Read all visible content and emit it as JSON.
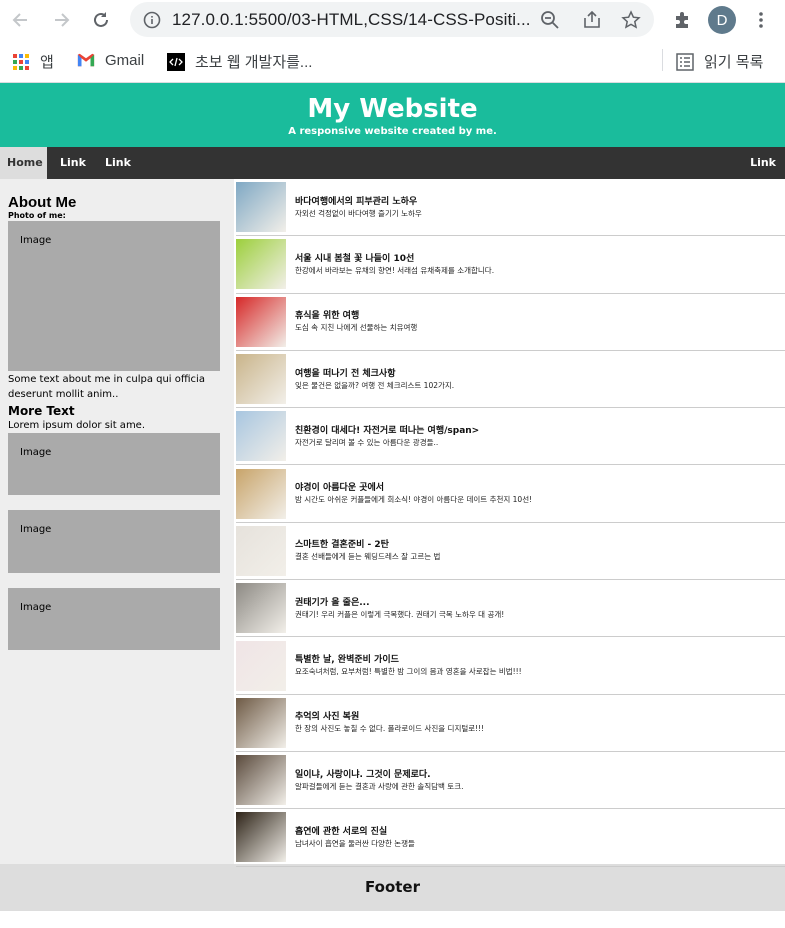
{
  "browser": {
    "url": "127.0.0.1:5500/03-HTML,CSS/14-CSS-Positi...",
    "avatar_letter": "D",
    "bookmarks": {
      "apps_label": "앱",
      "gmail_label": "Gmail",
      "dev_label": "초보 웹 개발자를...",
      "reading_list_label": "읽기 목록"
    }
  },
  "header": {
    "title": "My Website",
    "subtitle_pre": "A ",
    "subtitle_bold": "responsive",
    "subtitle_post": " website created by me."
  },
  "nav": {
    "home": "Home",
    "link1": "Link",
    "link2": "Link",
    "link_right": "Link"
  },
  "side": {
    "heading": "About Me",
    "photo_label": "Photo of me:",
    "image_label": "Image",
    "about_text": "Some text about me in culpa qui officia deserunt mollit anim..",
    "more_heading": "More Text",
    "more_text": "Lorem ipsum dolor sit ame.",
    "img2": "Image",
    "img3": "Image",
    "img4": "Image"
  },
  "list": [
    {
      "title": "바다여행에서의 피부관리 노하우",
      "desc": "자외선 걱정없이 바다여행 즐기기 노하우",
      "color": "#7fa8c4"
    },
    {
      "title": "서울 시내 봄철 꽃 나들이 10선",
      "desc": "한강에서 바라보는 유채의 향연! 서래섬 유채축제를 소개합니다.",
      "color": "#9ccf3c"
    },
    {
      "title": "휴식을 위한 여행",
      "desc": "도심 속 지친 나에게 선물하는 치유여행",
      "color": "#d62828"
    },
    {
      "title": "여행을 떠나기 전 체크사항",
      "desc": "잊은 물건은 없을까? 여행 전 체크리스트 102가지.",
      "color": "#c9b48a"
    },
    {
      "title": "친환경이 대세다! 자전거로 떠나는 여행/span>",
      "desc": "자전거로 달리며 볼 수 있는 아름다운 광경들..",
      "color": "#a8c6e0"
    },
    {
      "title": "야경이 아름다운 곳에서",
      "desc": "밤 시간도 아쉬운 커플들에게 희소식! 야경이 아름다운 데이트 추천지 10선!",
      "color": "#c8a46a"
    },
    {
      "title": "스마트한 결혼준비 - 2탄",
      "desc": "결혼 선배들에게 듣는 웨딩드레스 잘 고르는 법",
      "color": "#e6e2dc"
    },
    {
      "title": "권태기가 올 줄은...",
      "desc": "권태기! 우리 커플은 이렇게 극복했다. 권태기 극복 노하우 대 공개!",
      "color": "#8d8a84"
    },
    {
      "title": "특별한 날, 완벽준비 가이드",
      "desc": "요조숙녀처럼, 요부처럼! 특별한 밤 그이의 몸과 영혼을 사로잡는 비법!!!",
      "color": "#f0e4e6"
    },
    {
      "title": "추억의 사진 복원",
      "desc": "한 장의 사진도 놓칠 수 없다. 폴라로이드 사진을 디지털로!!!",
      "color": "#6e5a45"
    },
    {
      "title": "일이냐, 사랑이냐. 그것이 문제로다.",
      "desc": "알파걸들에게 듣는 결혼과 사랑에 관한 솔직담백 토크.",
      "color": "#5a4a3c"
    },
    {
      "title": "흡연에 관한 서로의 진실",
      "desc": "남녀사이 흡연을 둘러싼 다양한 논쟁들",
      "color": "#2e2418"
    }
  ],
  "footer": {
    "text": "Footer"
  }
}
